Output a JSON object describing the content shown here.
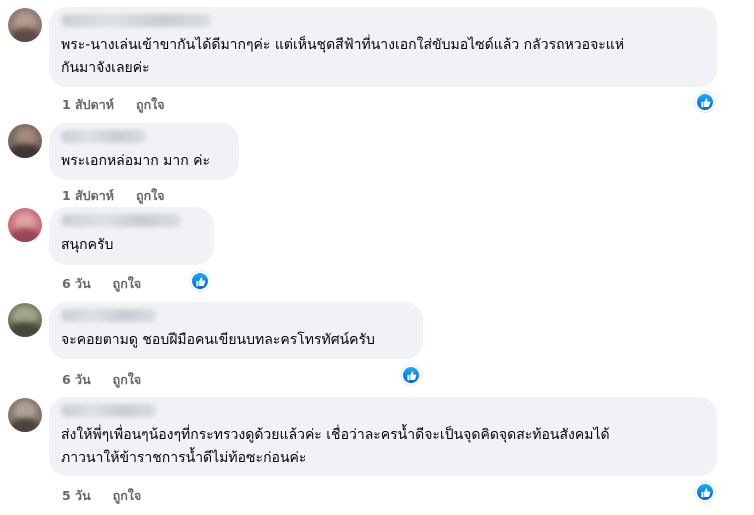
{
  "comments": [
    {
      "text_lines": [
        "พระ-นางเล่นเข้าขากันได้ดีมากๆค่ะ แต่เห็นชุดสีฟ้าที่นางเอกใส่ขับมอไซด์แล้ว กลัวรถหวอจะแห่",
        "กันมาจังเลยค่ะ"
      ],
      "time": "1 สัปดาห์",
      "like_label": "ถูกใจ"
    },
    {
      "text_lines": [
        "พระเอกหล่อมาก มาก ค่ะ"
      ],
      "time": "1 สัปดาห์",
      "like_label": "ถูกใจ"
    },
    {
      "text_lines": [
        "สนุกครับ"
      ],
      "time": "6 วัน",
      "like_label": "ถูกใจ"
    },
    {
      "text_lines": [
        "จะคอยตามดู ชอบฝีมือคนเขียนบทละครโทรทัศน์ครับ"
      ],
      "time": "6 วัน",
      "like_label": "ถูกใจ"
    },
    {
      "text_lines": [
        "ส่งให้พี่ๆเพื่อนๆน้องๆที่กระทรวงดูด้วยแล้วค่ะ เชื่อว่าละครน้ำดีจะเป็นจุดคิดจุดสะท้อนสังคมได้",
        "ภาวนาให้ข้าราชการน้ำดีไม่ท้อซะก่อนค่ะ"
      ],
      "time": "5 วัน",
      "like_label": "ถูกใจ"
    }
  ],
  "colors": {
    "bubble_bg": "#f0f2f5",
    "meta_text": "#65676b",
    "like_blue": "#0571ed"
  },
  "icons": {
    "reaction": "thumbs-up-icon"
  }
}
